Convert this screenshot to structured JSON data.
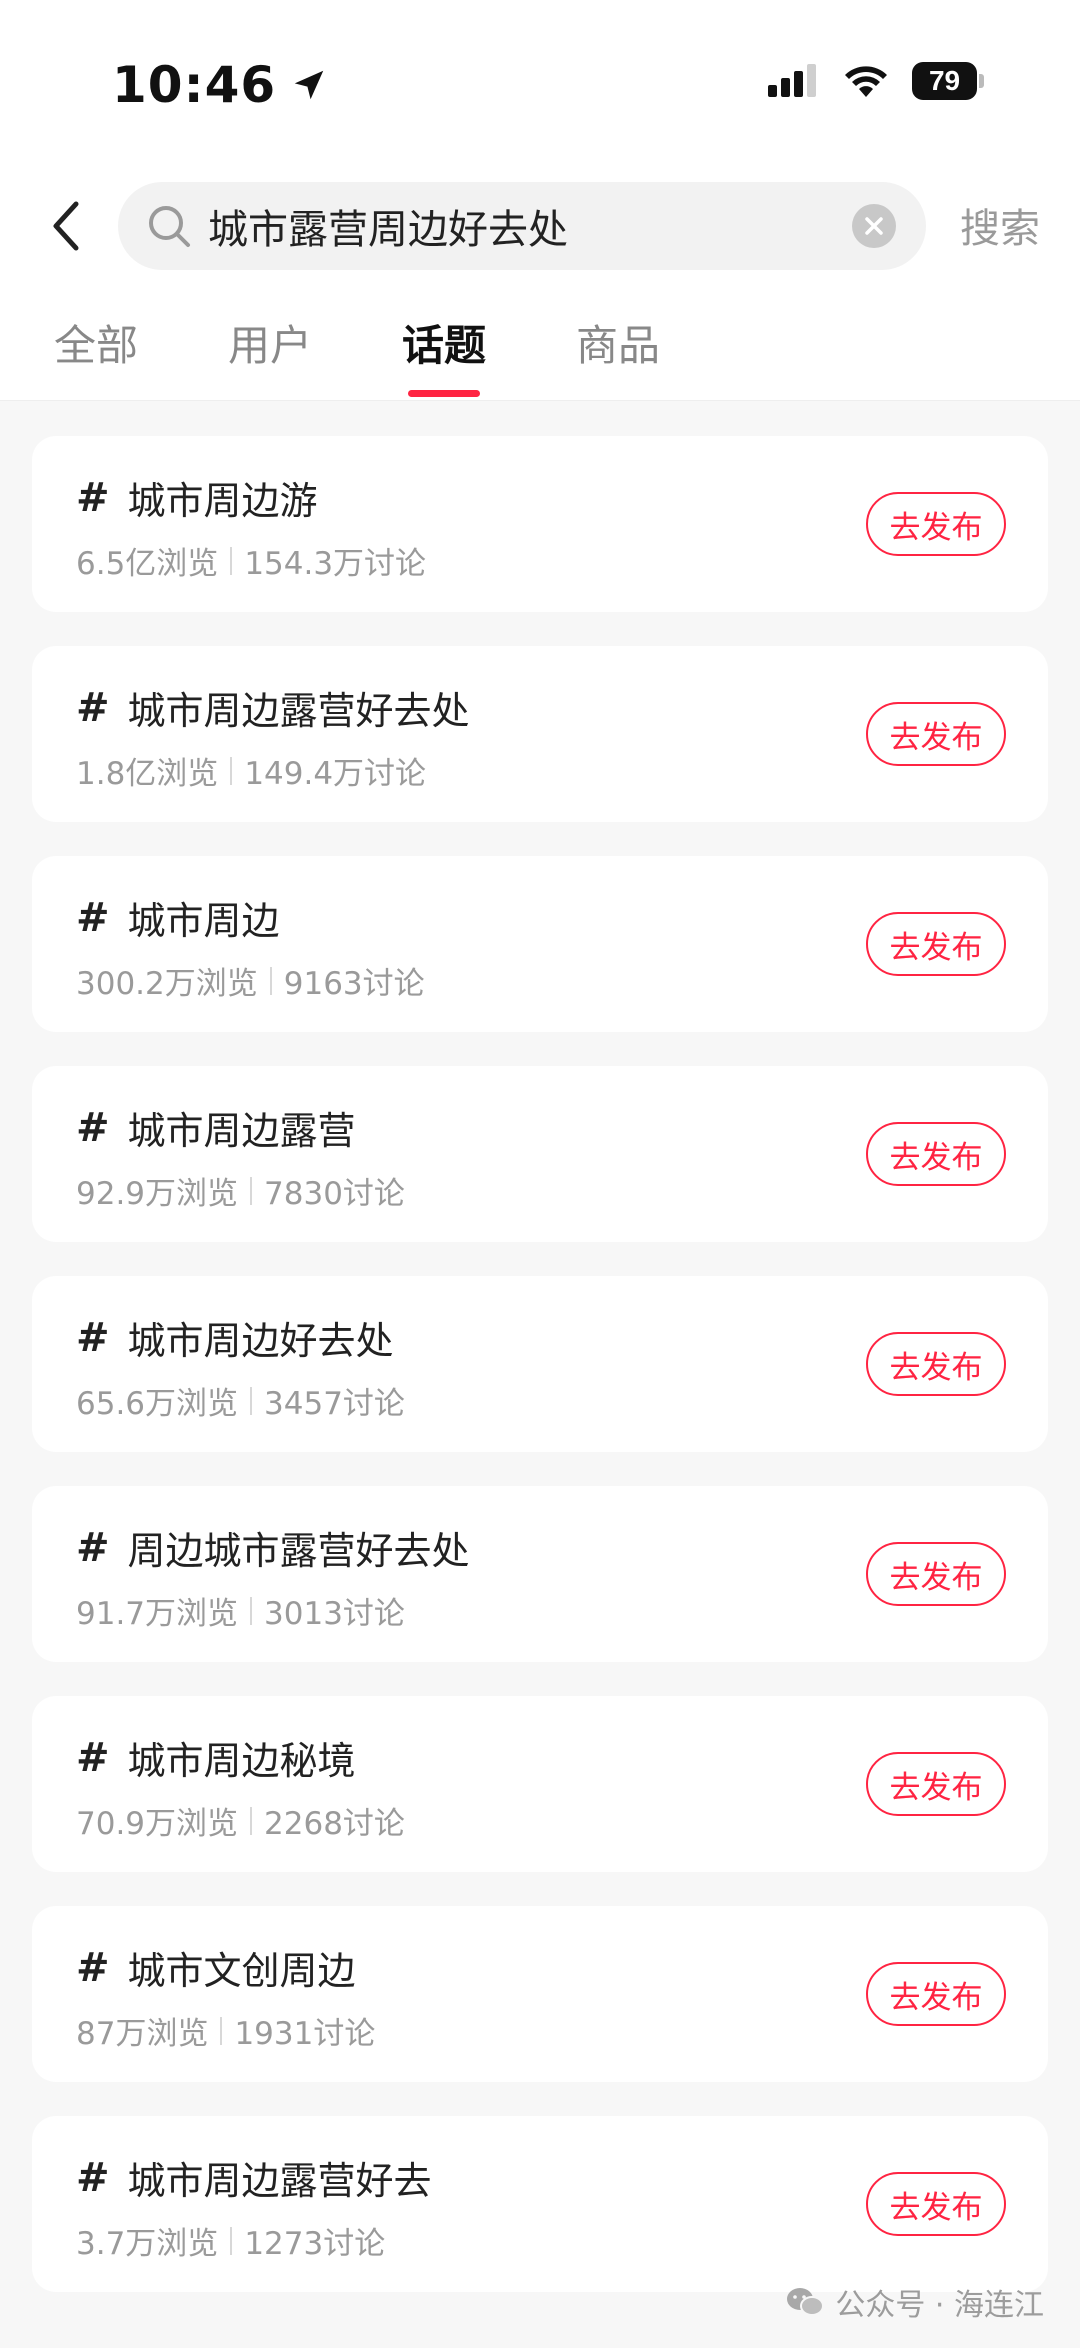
{
  "status_bar": {
    "time": "10:46",
    "battery": "79"
  },
  "search": {
    "query": "城市露营周边好去处",
    "button_label": "搜索"
  },
  "tabs": [
    {
      "label": "全部"
    },
    {
      "label": "用户"
    },
    {
      "label": "话题",
      "active": true
    },
    {
      "label": "商品"
    }
  ],
  "topics": [
    {
      "hash": "#",
      "title": "城市周边游",
      "views": "6.5亿浏览",
      "discussions": "154.3万讨论",
      "action": "去发布"
    },
    {
      "hash": "#",
      "title": "城市周边露营好去处",
      "views": "1.8亿浏览",
      "discussions": "149.4万讨论",
      "action": "去发布"
    },
    {
      "hash": "#",
      "title": "城市周边",
      "views": "300.2万浏览",
      "discussions": "9163讨论",
      "action": "去发布"
    },
    {
      "hash": "#",
      "title": "城市周边露营",
      "views": "92.9万浏览",
      "discussions": "7830讨论",
      "action": "去发布"
    },
    {
      "hash": "#",
      "title": "城市周边好去处",
      "views": "65.6万浏览",
      "discussions": "3457讨论",
      "action": "去发布"
    },
    {
      "hash": "#",
      "title": "周边城市露营好去处",
      "views": "91.7万浏览",
      "discussions": "3013讨论",
      "action": "去发布"
    },
    {
      "hash": "#",
      "title": "城市周边秘境",
      "views": "70.9万浏览",
      "discussions": "2268讨论",
      "action": "去发布"
    },
    {
      "hash": "#",
      "title": "城市文创周边",
      "views": "87万浏览",
      "discussions": "1931讨论",
      "action": "去发布"
    },
    {
      "hash": "#",
      "title": "城市周边露营好去",
      "views": "3.7万浏览",
      "discussions": "1273讨论",
      "action": "去发布"
    }
  ],
  "watermark": "公众号 · 海连江",
  "colors": {
    "accent": "#ff2442",
    "background": "#f7f7f7",
    "muted_text": "#9a9a9a"
  },
  "icons": [
    "location-arrow-icon",
    "signal-icon",
    "wifi-icon",
    "battery-icon",
    "back-chevron-icon",
    "search-icon",
    "clear-icon",
    "hash-icon",
    "wechat-icon"
  ]
}
